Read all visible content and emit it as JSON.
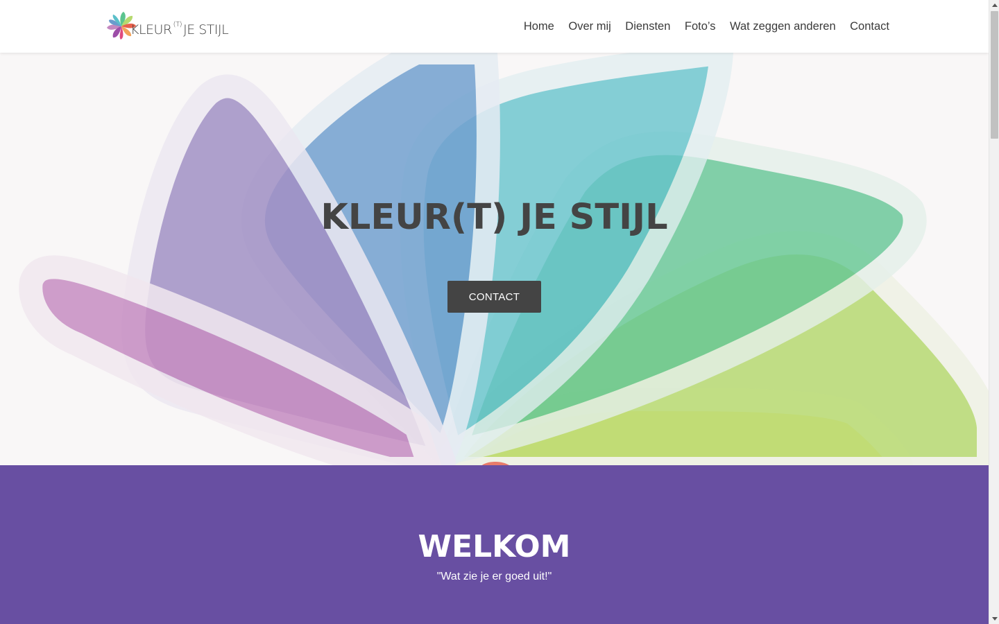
{
  "brand": {
    "logo_text_main": "KLEUR",
    "logo_text_sup": "(T)",
    "logo_text_rest": "JE STIJL"
  },
  "nav": {
    "items": [
      {
        "label": "Home"
      },
      {
        "label": "Over mij"
      },
      {
        "label": "Diensten"
      },
      {
        "label": "Foto’s"
      },
      {
        "label": "Wat zeggen anderen"
      },
      {
        "label": "Contact"
      }
    ]
  },
  "hero": {
    "title": "KLEUR(T) JE STIJL",
    "button_label": "CONTACT"
  },
  "welcome": {
    "heading": "WELKOM",
    "tagline": "\"Wat zie je er goed uit!\""
  },
  "colors": {
    "header_bg": "#ffffff",
    "hero_bg": "#f9f7f7",
    "button_bg": "#444444",
    "welcome_bg": "#684fa2",
    "petal_magenta": "#c488c0",
    "petal_purple": "#9d8bc2",
    "petal_blue": "#6a9ccd",
    "petal_teal": "#5bbfc9",
    "petal_green": "#5cc48f",
    "petal_lime": "#b6d96f",
    "petal_yellow": "#f3df5a",
    "petal_red": "#e8604c"
  },
  "icons": {
    "logo": "color-wheel-flower-icon",
    "scroll_up": "triangle-up-icon",
    "scroll_down": "triangle-down-icon"
  }
}
